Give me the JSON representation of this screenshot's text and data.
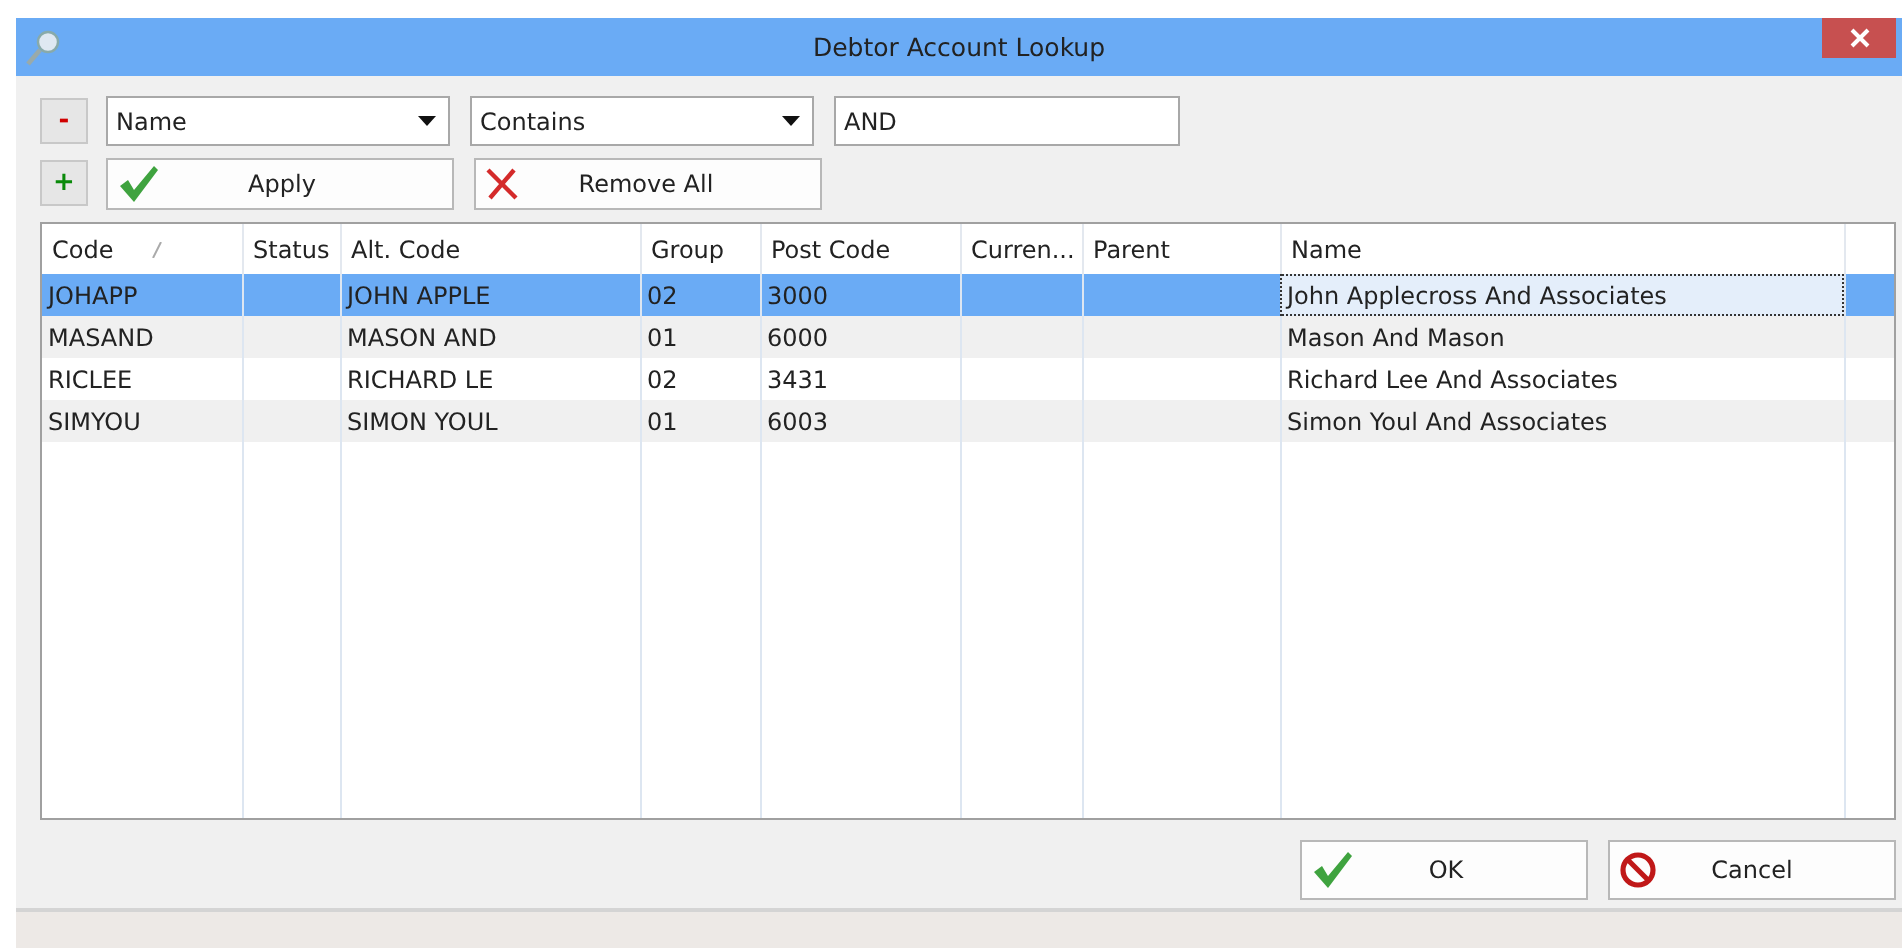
{
  "window": {
    "title": "Debtor Account Lookup"
  },
  "filter": {
    "field": "Name",
    "operator": "Contains",
    "value": "AND",
    "remove_label": "-",
    "add_label": "+"
  },
  "actions": [
    {
      "label": "Apply",
      "kind": "apply"
    },
    {
      "label": "Remove All",
      "kind": "remove"
    }
  ],
  "table": {
    "columns": [
      {
        "label": "Code",
        "sorted": true
      },
      {
        "label": "Status",
        "sorted": false
      },
      {
        "label": "Alt. Code",
        "sorted": false
      },
      {
        "label": "Group",
        "sorted": false
      },
      {
        "label": "Post Code",
        "sorted": false
      },
      {
        "label": "Curren...",
        "sorted": false
      },
      {
        "label": "Parent",
        "sorted": false
      },
      {
        "label": "Name",
        "sorted": false
      }
    ],
    "rows": [
      {
        "selected": true,
        "cells": [
          "JOHAPP",
          "",
          "JOHN APPLE",
          "02",
          "3000",
          "",
          "",
          "John Applecross And Associates"
        ]
      },
      {
        "selected": false,
        "cells": [
          "MASAND",
          "",
          "MASON AND",
          "01",
          "6000",
          "",
          "",
          "Mason And Mason"
        ]
      },
      {
        "selected": false,
        "cells": [
          "RICLEE",
          "",
          "RICHARD LE",
          "02",
          "3431",
          "",
          "",
          "Richard Lee And Associates"
        ]
      },
      {
        "selected": false,
        "cells": [
          "SIMYOU",
          "",
          "SIMON YOUL",
          "01",
          "6003",
          "",
          "",
          "Simon Youl And Associates"
        ]
      }
    ]
  },
  "buttons": [
    {
      "label": "OK",
      "kind": "ok"
    },
    {
      "label": "Cancel",
      "kind": "cancel"
    }
  ]
}
